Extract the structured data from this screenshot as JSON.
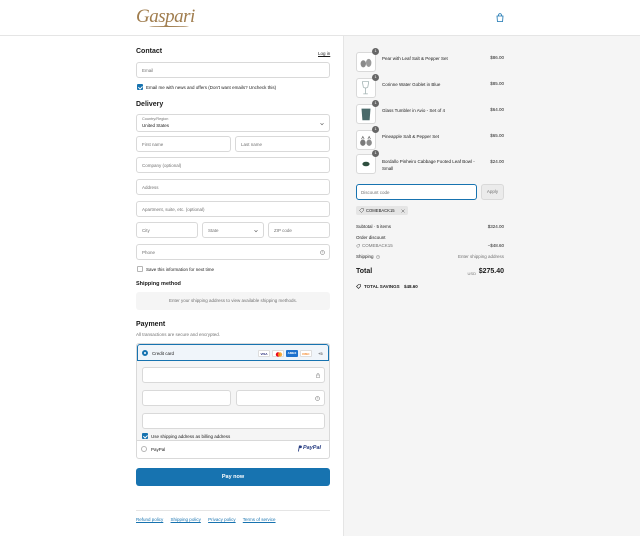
{
  "brand": {
    "logo_text": "Gaspari"
  },
  "contact": {
    "title": "Contact",
    "login_label": "Log in",
    "email_placeholder": "Email",
    "news_label": "Email me with news and offers (Don't want emails? Uncheck this)"
  },
  "delivery": {
    "title": "Delivery",
    "country_label": "Country/Region",
    "country_value": "United States",
    "first_name": "First name",
    "last_name": "Last name",
    "company": "Company (optional)",
    "address": "Address",
    "apartment": "Apartment, suite, etc. (optional)",
    "city": "City",
    "state": "State",
    "zip": "ZIP code",
    "phone": "Phone",
    "save_label": "Save this information for next time"
  },
  "shipping": {
    "title": "Shipping method",
    "note": "Enter your shipping address to view available shipping methods."
  },
  "payment": {
    "title": "Payment",
    "subtitle": "All transactions are secure and encrypted.",
    "credit_card_label": "Credit card",
    "cards": [
      "VISA",
      "MC",
      "AMEX",
      "DISC"
    ],
    "more_cards": "+5",
    "billing_label": "Use shipping address as billing address",
    "paypal_label": "PayPal",
    "paypal_logo": "PayPal",
    "pay_button": "Pay now"
  },
  "footer": {
    "links": [
      "Refund policy",
      "Shipping policy",
      "Privacy policy",
      "Terms of service"
    ]
  },
  "cart": {
    "items": [
      {
        "qty": "1",
        "name": "Pear with Leaf Salt & Pepper Set",
        "price": "$86.00"
      },
      {
        "qty": "1",
        "name": "Corinne Water Goblet in Blue",
        "price": "$85.00"
      },
      {
        "qty": "1",
        "name": "Glass Tumbler in Avio - Set of 4",
        "price": "$64.00"
      },
      {
        "qty": "1",
        "name": "Pineapple Salt & Pepper Set",
        "price": "$65.00"
      },
      {
        "qty": "1",
        "name": "Bordallo Pinheiro Cabbage Footed Leaf Bowl - Small",
        "price": "$24.00"
      }
    ],
    "discount_placeholder": "Discount code",
    "apply_label": "Apply",
    "applied_code": "COMEBACK15",
    "subtotal_label": "Subtotal · 5 items",
    "subtotal_value": "$324.00",
    "order_discount_label": "Order discount",
    "order_discount_code": "COMEBACK15",
    "order_discount_value": "−$48.60",
    "shipping_label": "Shipping",
    "shipping_value": "Enter shipping address",
    "total_label": "Total",
    "currency": "USD",
    "total_value": "$275.40",
    "savings_label": "TOTAL SAVINGS",
    "savings_value": "$48.60"
  },
  "colors": {
    "accent": "#1773b0",
    "brand_gold": "#a07d4e",
    "sidebar_bg": "#f5f5f5"
  }
}
